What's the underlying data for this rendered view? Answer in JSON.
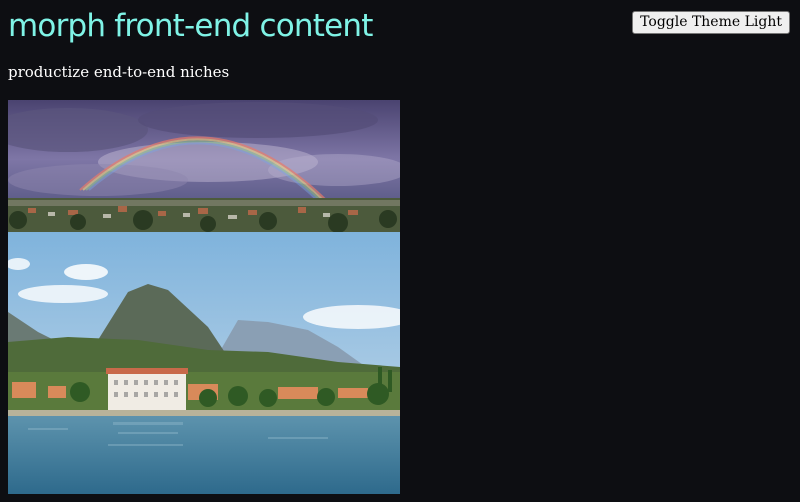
{
  "header": {
    "title": "morph front-end content",
    "toggle_button_label": "Toggle Theme Light"
  },
  "main": {
    "subtitle": "productize end-to-end niches"
  },
  "colors": {
    "background": "#0d0e12",
    "title_accent": "#7ff3e6",
    "text": "#ffffff"
  }
}
